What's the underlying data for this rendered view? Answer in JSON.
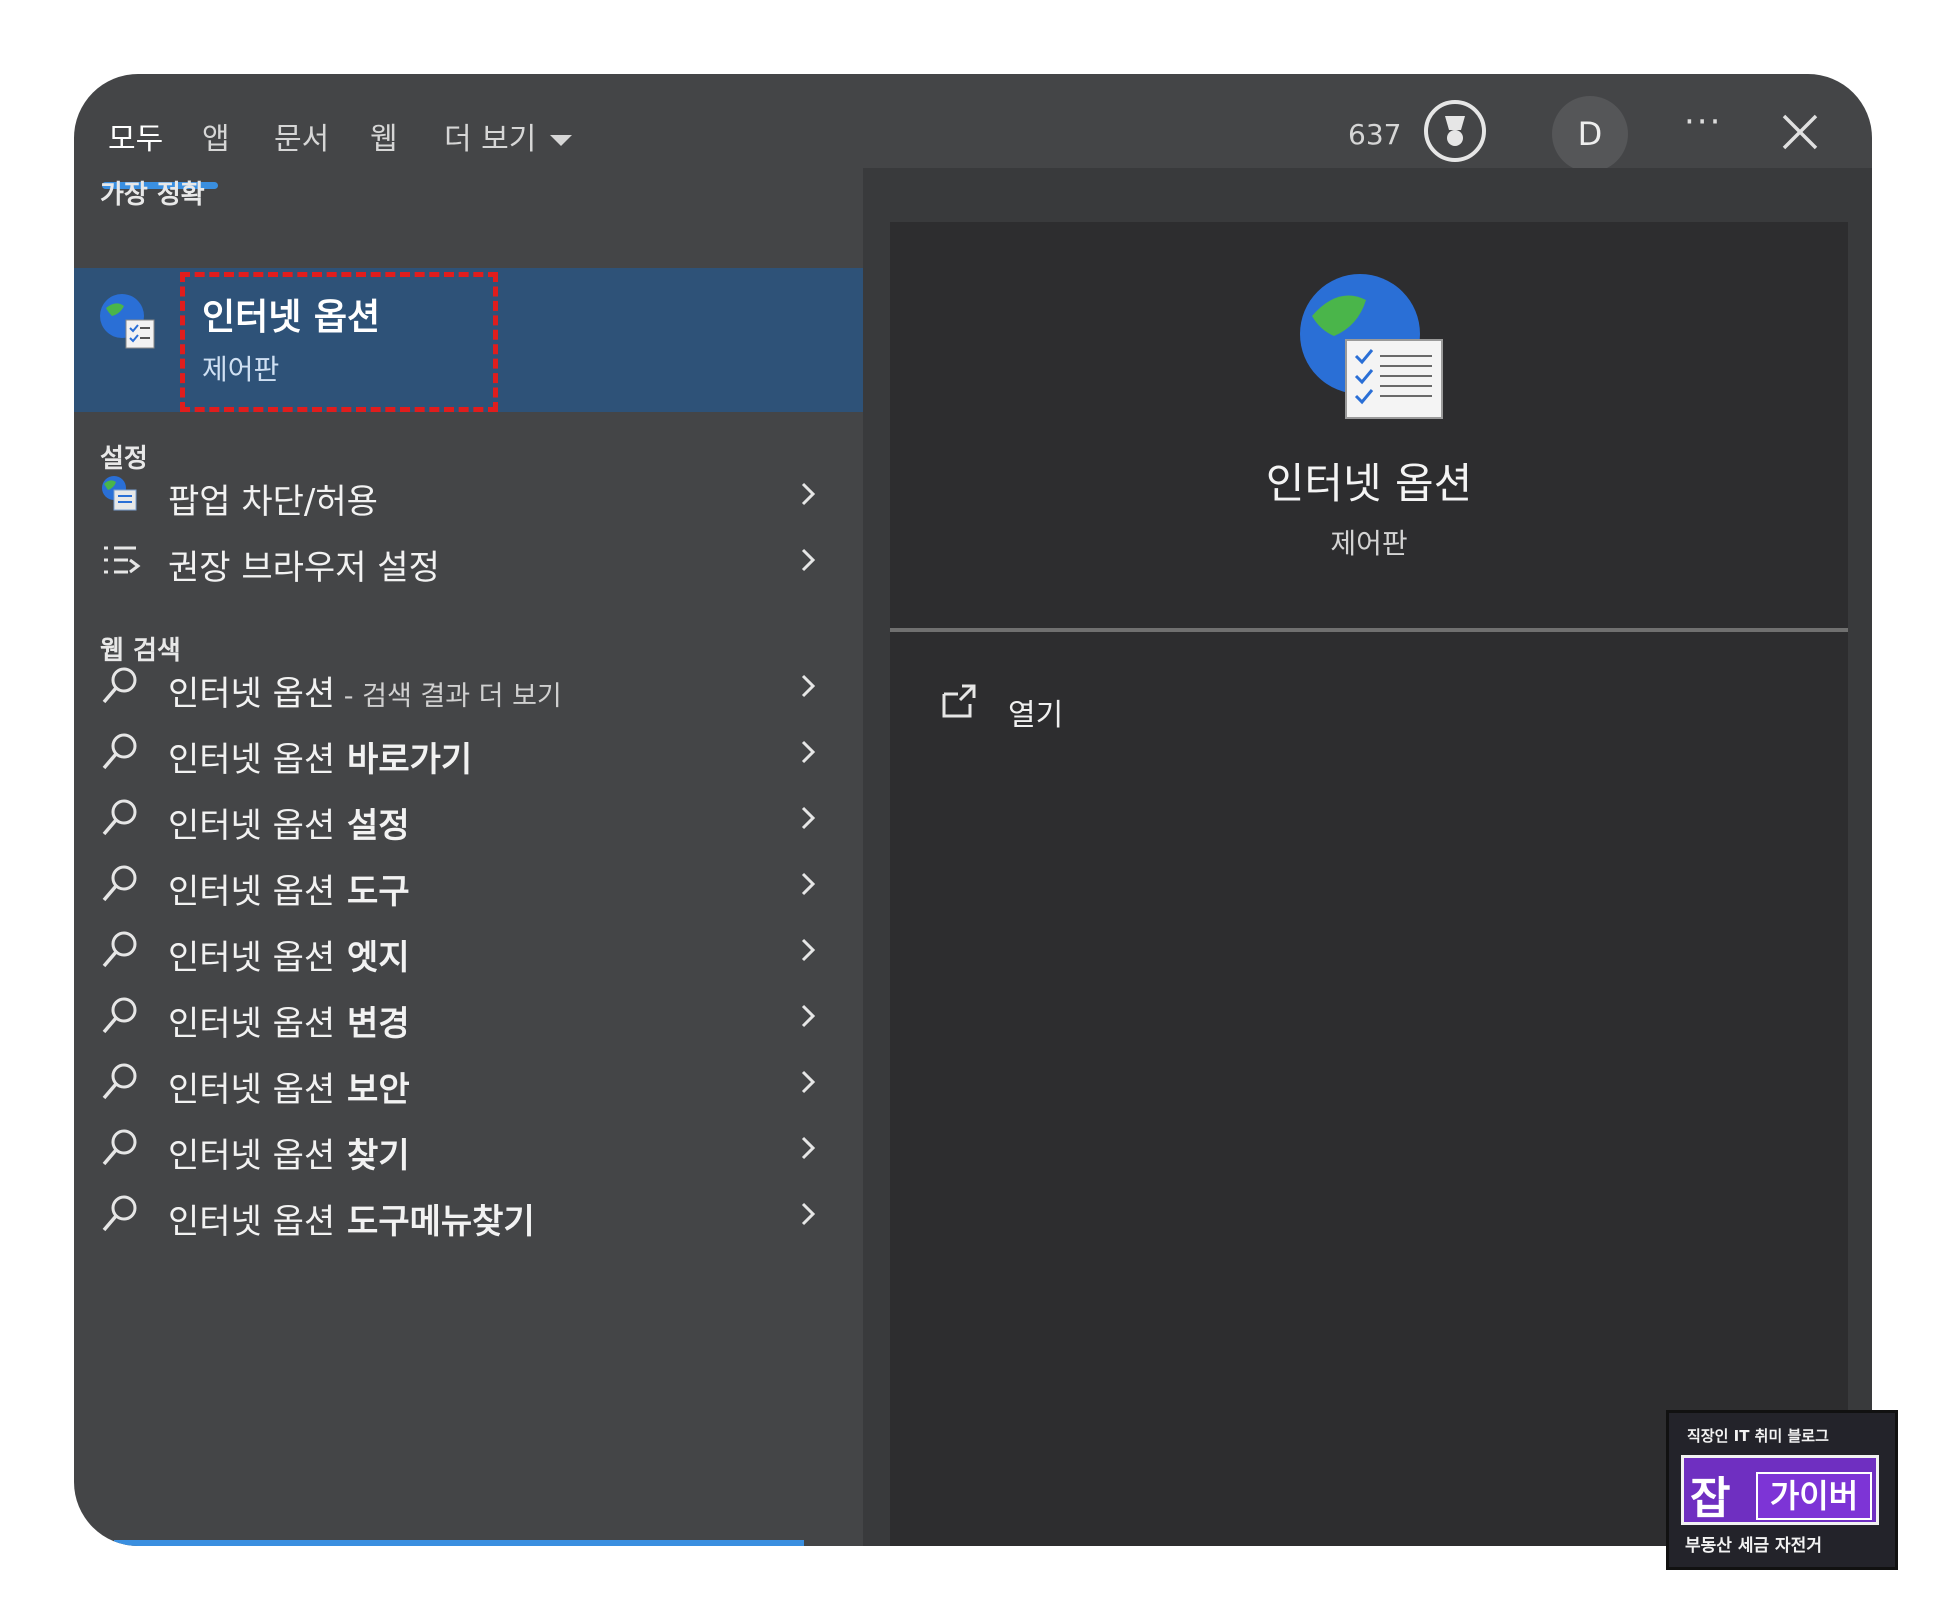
{
  "tabs": [
    {
      "label": "모두",
      "active": true
    },
    {
      "label": "앱"
    },
    {
      "label": "문서"
    },
    {
      "label": "웹"
    },
    {
      "label": "더 보기"
    }
  ],
  "header": {
    "points": "637",
    "avatar_letter": "D",
    "more_label": "···"
  },
  "left": {
    "best_match_heading": "가장 정확",
    "best_match": {
      "title": "인터넷 옵션",
      "subtitle": "제어판",
      "icon": "internet-options-globe-icon"
    },
    "settings_heading": "설정",
    "settings": [
      {
        "label": "팝업 차단/허용",
        "icon": "popup-settings-icon"
      },
      {
        "label": "권장 브라우저 설정",
        "icon": "list-settings-icon"
      }
    ],
    "web_heading": "웹 검색",
    "web": [
      {
        "prefix": "인터넷 옵션",
        "suffix": "",
        "note": " - 검색 결과 더 보기"
      },
      {
        "prefix": "인터넷 옵션",
        "suffix": " 바로가기"
      },
      {
        "prefix": "인터넷 옵션",
        "suffix": " 설정"
      },
      {
        "prefix": "인터넷 옵션",
        "suffix": " 도구"
      },
      {
        "prefix": "인터넷 옵션",
        "suffix": " 엣지"
      },
      {
        "prefix": "인터넷 옵션",
        "suffix": " 변경"
      },
      {
        "prefix": "인터넷 옵션",
        "suffix": " 보안"
      },
      {
        "prefix": "인터넷 옵션",
        "suffix": " 찾기"
      },
      {
        "prefix": "인터넷 옵션",
        "suffix": " 도구메뉴찾기"
      }
    ]
  },
  "detail": {
    "title": "인터넷 옵션",
    "subtitle": "제어판",
    "action_open": "열기"
  },
  "watermark": {
    "top": "직장인 IT 취미 블로그",
    "left": "잡",
    "right": "가이버",
    "bottom": "부동산 세금 자전거"
  },
  "colors": {
    "accent": "#3a8fe0",
    "selection": "#2e5278",
    "highlight_box": "#e01d1d"
  }
}
